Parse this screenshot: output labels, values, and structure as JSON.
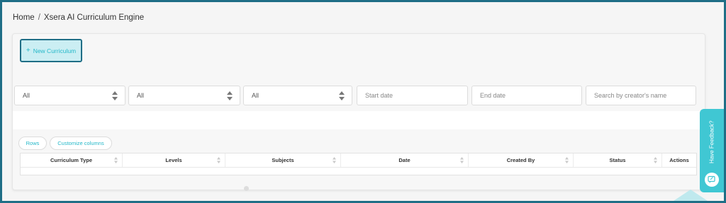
{
  "breadcrumb": {
    "home": "Home",
    "separator": "/",
    "current": "Xsera AI Curriculum Engine"
  },
  "toolbar": {
    "new_curriculum_label": "New Curriculum",
    "plus_icon": "+"
  },
  "filters": {
    "select1": "All",
    "select2": "All",
    "select3": "All",
    "start_date_placeholder": "Start date",
    "end_date_placeholder": "End date",
    "search_placeholder": "Search by creator's name"
  },
  "table_controls": {
    "rows_label": "Rows",
    "customize_label": "Customize columns"
  },
  "table": {
    "columns": [
      "Curriculum Type",
      "Levels",
      "Subjects",
      "Date",
      "Created By",
      "Status",
      "Actions"
    ]
  },
  "feedback": {
    "label": "Have Feedback?"
  },
  "colors": {
    "accent": "#25b8c9",
    "frame": "#1f6e86",
    "feedback_bg": "#40c7d3"
  }
}
